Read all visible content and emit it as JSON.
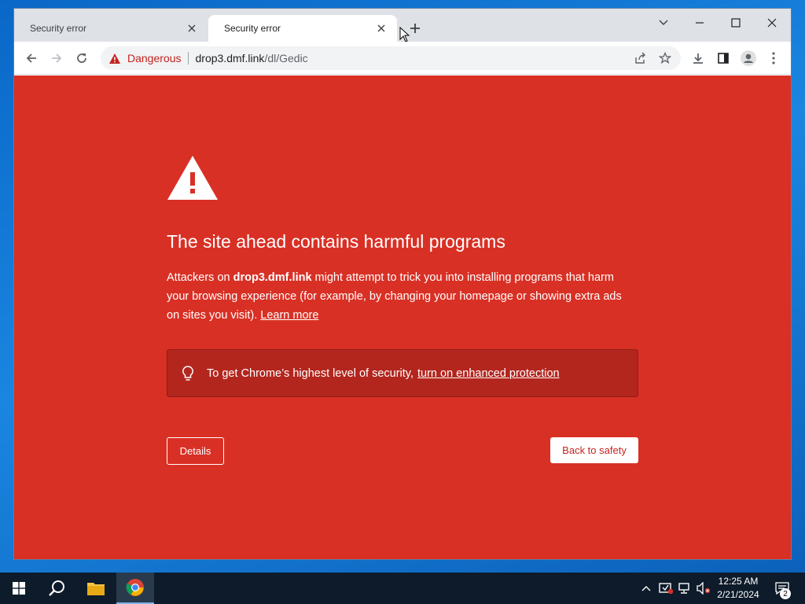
{
  "browser": {
    "tabs": [
      {
        "title": "Security error",
        "active": false
      },
      {
        "title": "Security error",
        "active": true
      }
    ],
    "omnibox": {
      "security_label": "Dangerous",
      "host": "drop3.dmf.link",
      "path": "/dl/Gedic"
    }
  },
  "page": {
    "headline": "The site ahead contains harmful programs",
    "desc_prefix": "Attackers on ",
    "desc_host": "drop3.dmf.link",
    "desc_body": " might attempt to trick you into installing programs that harm your browsing experience (for example, by changing your homepage or showing extra ads on sites you visit). ",
    "learn_more": "Learn more",
    "tip_text": "To get Chrome’s highest level of security,",
    "tip_link": "turn on enhanced protection",
    "details_button": "Details",
    "back_button": "Back to safety",
    "colors": {
      "background": "#d93025",
      "tip_box": "#b3261e",
      "danger_text": "#c5221f"
    }
  },
  "taskbar": {
    "time": "12:25 AM",
    "date": "2/21/2024",
    "notification_count": "2"
  }
}
